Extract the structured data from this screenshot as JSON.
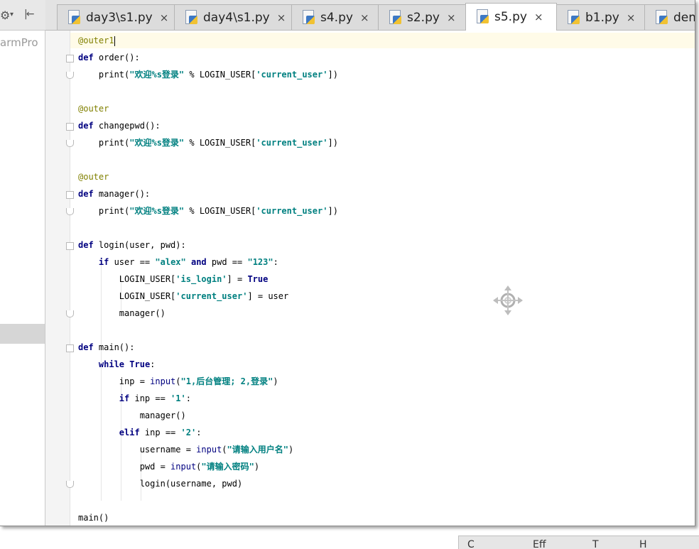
{
  "project": {
    "name_fragment": "armPro",
    "gear_glyph": "⚙",
    "caret_glyph": "▾",
    "pin_glyph": "|←"
  },
  "tabs": [
    {
      "label": "day3\\s1.py",
      "active": false,
      "close": "×"
    },
    {
      "label": "day4\\s1.py",
      "active": false,
      "close": "×"
    },
    {
      "label": "s4.py",
      "active": false,
      "close": "×"
    },
    {
      "label": "s2.py",
      "active": false,
      "close": "×"
    },
    {
      "label": "s5.py",
      "active": true,
      "close": "×"
    },
    {
      "label": "b1.py",
      "active": false,
      "close": "×"
    },
    {
      "label": "dem",
      "active": false,
      "close": ""
    }
  ],
  "code": {
    "lines": [
      [
        {
          "t": "@outer1",
          "c": "deco"
        },
        {
          "t": "",
          "c": "cursor"
        }
      ],
      [
        {
          "t": "def",
          "c": "kw"
        },
        {
          "t": " order():",
          "c": ""
        }
      ],
      [
        {
          "t": "    print(",
          "c": ""
        },
        {
          "t": "\"欢迎%s登录\"",
          "c": "str"
        },
        {
          "t": " % LOGIN_USER[",
          "c": ""
        },
        {
          "t": "'current_user'",
          "c": "str"
        },
        {
          "t": "])",
          "c": ""
        }
      ],
      [],
      [
        {
          "t": "@outer",
          "c": "deco"
        }
      ],
      [
        {
          "t": "def",
          "c": "kw"
        },
        {
          "t": " changepwd():",
          "c": ""
        }
      ],
      [
        {
          "t": "    print(",
          "c": ""
        },
        {
          "t": "\"欢迎%s登录\"",
          "c": "str"
        },
        {
          "t": " % LOGIN_USER[",
          "c": ""
        },
        {
          "t": "'current_user'",
          "c": "str"
        },
        {
          "t": "])",
          "c": ""
        }
      ],
      [],
      [
        {
          "t": "@outer",
          "c": "deco"
        }
      ],
      [
        {
          "t": "def",
          "c": "kw"
        },
        {
          "t": " manager():",
          "c": ""
        }
      ],
      [
        {
          "t": "    print(",
          "c": ""
        },
        {
          "t": "\"欢迎%s登录\"",
          "c": "str"
        },
        {
          "t": " % LOGIN_USER[",
          "c": ""
        },
        {
          "t": "'current_user'",
          "c": "str"
        },
        {
          "t": "])",
          "c": ""
        }
      ],
      [],
      [
        {
          "t": "def",
          "c": "kw"
        },
        {
          "t": " login(user, pwd):",
          "c": ""
        }
      ],
      [
        {
          "t": "    ",
          "c": ""
        },
        {
          "t": "if",
          "c": "kw"
        },
        {
          "t": " user == ",
          "c": ""
        },
        {
          "t": "\"alex\"",
          "c": "str"
        },
        {
          "t": " ",
          "c": ""
        },
        {
          "t": "and",
          "c": "kw"
        },
        {
          "t": " pwd == ",
          "c": ""
        },
        {
          "t": "\"123\"",
          "c": "str"
        },
        {
          "t": ":",
          "c": ""
        }
      ],
      [
        {
          "t": "        LOGIN_USER[",
          "c": ""
        },
        {
          "t": "'is_login'",
          "c": "str"
        },
        {
          "t": "] = ",
          "c": ""
        },
        {
          "t": "True",
          "c": "kw"
        }
      ],
      [
        {
          "t": "        LOGIN_USER[",
          "c": ""
        },
        {
          "t": "'current_user'",
          "c": "str"
        },
        {
          "t": "] = user",
          "c": ""
        }
      ],
      [
        {
          "t": "        manager()",
          "c": ""
        }
      ],
      [],
      [
        {
          "t": "def",
          "c": "kw"
        },
        {
          "t": " main():",
          "c": ""
        }
      ],
      [
        {
          "t": "    ",
          "c": ""
        },
        {
          "t": "while",
          "c": "kw"
        },
        {
          "t": " ",
          "c": ""
        },
        {
          "t": "True",
          "c": "kw"
        },
        {
          "t": ":",
          "c": ""
        }
      ],
      [
        {
          "t": "        inp = ",
          "c": ""
        },
        {
          "t": "input",
          "c": "fn"
        },
        {
          "t": "(",
          "c": ""
        },
        {
          "t": "\"1,后台管理; 2,登录\"",
          "c": "str"
        },
        {
          "t": ")",
          "c": ""
        }
      ],
      [
        {
          "t": "        ",
          "c": ""
        },
        {
          "t": "if",
          "c": "kw"
        },
        {
          "t": " inp == ",
          "c": ""
        },
        {
          "t": "'1'",
          "c": "str"
        },
        {
          "t": ":",
          "c": ""
        }
      ],
      [
        {
          "t": "            manager()",
          "c": ""
        }
      ],
      [
        {
          "t": "        ",
          "c": ""
        },
        {
          "t": "elif",
          "c": "kw"
        },
        {
          "t": " inp == ",
          "c": ""
        },
        {
          "t": "'2'",
          "c": "str"
        },
        {
          "t": ":",
          "c": ""
        }
      ],
      [
        {
          "t": "            username = ",
          "c": ""
        },
        {
          "t": "input",
          "c": "fn"
        },
        {
          "t": "(",
          "c": ""
        },
        {
          "t": "\"请输入用户名\"",
          "c": "str"
        },
        {
          "t": ")",
          "c": ""
        }
      ],
      [
        {
          "t": "            pwd = ",
          "c": ""
        },
        {
          "t": "input",
          "c": "fn"
        },
        {
          "t": "(",
          "c": ""
        },
        {
          "t": "\"请输入密码\"",
          "c": "str"
        },
        {
          "t": ")",
          "c": ""
        }
      ],
      [
        {
          "t": "            login(username, pwd)",
          "c": ""
        }
      ],
      [],
      [
        {
          "t": "main()",
          "c": ""
        }
      ]
    ]
  },
  "bottom_menu": {
    "items": [
      "C",
      "Eff",
      "T",
      "H"
    ]
  }
}
